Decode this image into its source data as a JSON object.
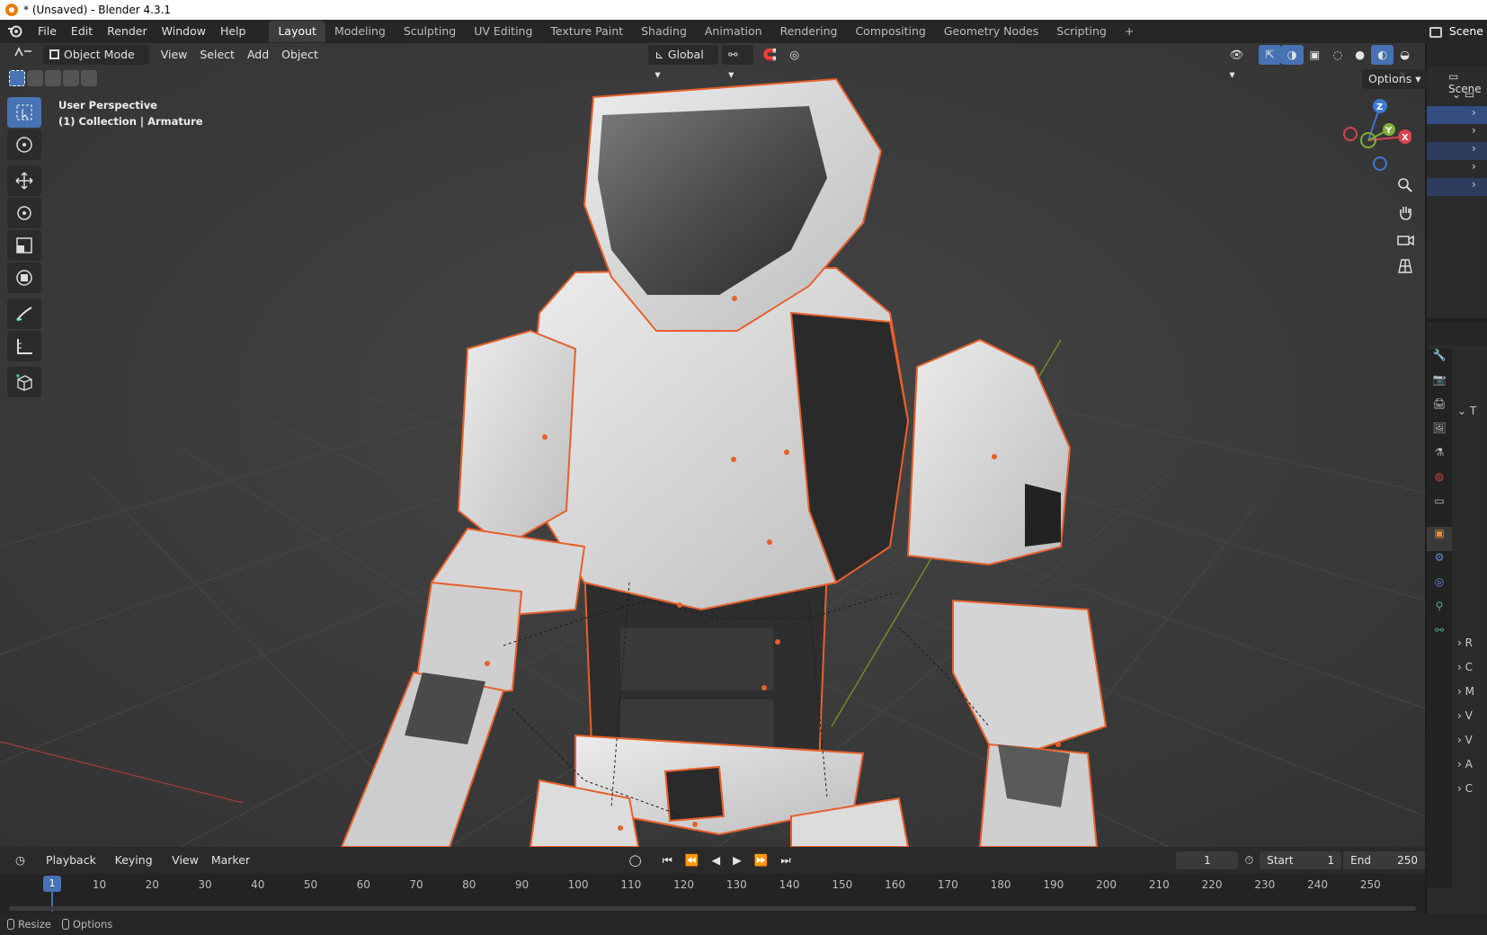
{
  "window": {
    "title": "* (Unsaved) - Blender 4.3.1"
  },
  "menubar": {
    "items": [
      "File",
      "Edit",
      "Render",
      "Window",
      "Help"
    ],
    "workspaces": [
      "Layout",
      "Modeling",
      "Sculpting",
      "UV Editing",
      "Texture Paint",
      "Shading",
      "Animation",
      "Rendering",
      "Compositing",
      "Geometry Nodes",
      "Scripting"
    ],
    "active_workspace": "Layout",
    "add_tab": "+",
    "scene": "Scene"
  },
  "viewport_header": {
    "mode": "Object Mode",
    "menus": [
      "View",
      "Select",
      "Add",
      "Object"
    ],
    "orientation": "Global",
    "options": "Options"
  },
  "viewport": {
    "perspective": "User Perspective",
    "collection": "(1) Collection | Armature",
    "gizmo": {
      "x": "X",
      "y": "Y",
      "z": "Z"
    }
  },
  "timeline": {
    "menus": [
      "Playback",
      "Keying",
      "View",
      "Marker"
    ],
    "current_frame": "1",
    "start_label": "Start",
    "start": "1",
    "end_label": "End",
    "end": "250",
    "ruler": [
      "1",
      "10",
      "20",
      "30",
      "40",
      "50",
      "60",
      "70",
      "80",
      "90",
      "100",
      "110",
      "120",
      "130",
      "140",
      "150",
      "160",
      "170",
      "180",
      "190",
      "200",
      "210",
      "220",
      "230",
      "240",
      "250"
    ]
  },
  "statusbar": {
    "left": "Resize",
    "right": "Options"
  },
  "properties": {
    "section_letters": [
      "T",
      "R",
      "C",
      "M",
      "V",
      "V",
      "A",
      "C"
    ]
  },
  "colors": {
    "accent": "#4772b3",
    "selection": "#e8602a",
    "gizmo_x": "#d9434f",
    "gizmo_y": "#7fb03a",
    "gizmo_z": "#3d78d6"
  }
}
